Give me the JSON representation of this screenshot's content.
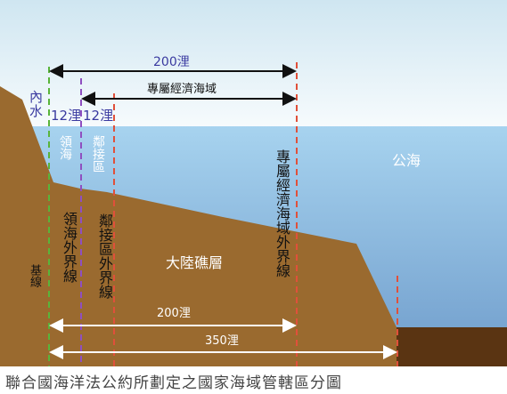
{
  "labels": {
    "internal_waters": "內水",
    "nm200_top": "200浬",
    "eez_top": "專屬經濟海域",
    "nm12_a": "12浬",
    "nm12_b": "12浬",
    "territorial_sea_water": "領海",
    "contiguous_zone_water": "鄰接區",
    "eez_vertical": "專屬經濟海域外界線",
    "high_seas": "公海",
    "territorial_limit": "領海外界線",
    "contiguous_limit": "鄰接區外界線",
    "continental_shelf": "大陸礁層",
    "baseline": "基線",
    "nm200_bottom": "200浬",
    "nm350_bottom": "350浬"
  },
  "caption": "聯合國海洋法公約所劃定之國家海域管轄區分圖",
  "colors": {
    "land": "#9a6a2f",
    "sea_top": "#9ccbea",
    "sea_bottom": "#6f9ecb",
    "sky_top": "#d9ecf4",
    "deep_floor": "#5a3412",
    "baseline_line": "#59b43a",
    "territorial_line": "#8f4fc0",
    "red_line": "#e0503a",
    "label_blue": "#3a3aa0",
    "text_dark": "#222222"
  }
}
